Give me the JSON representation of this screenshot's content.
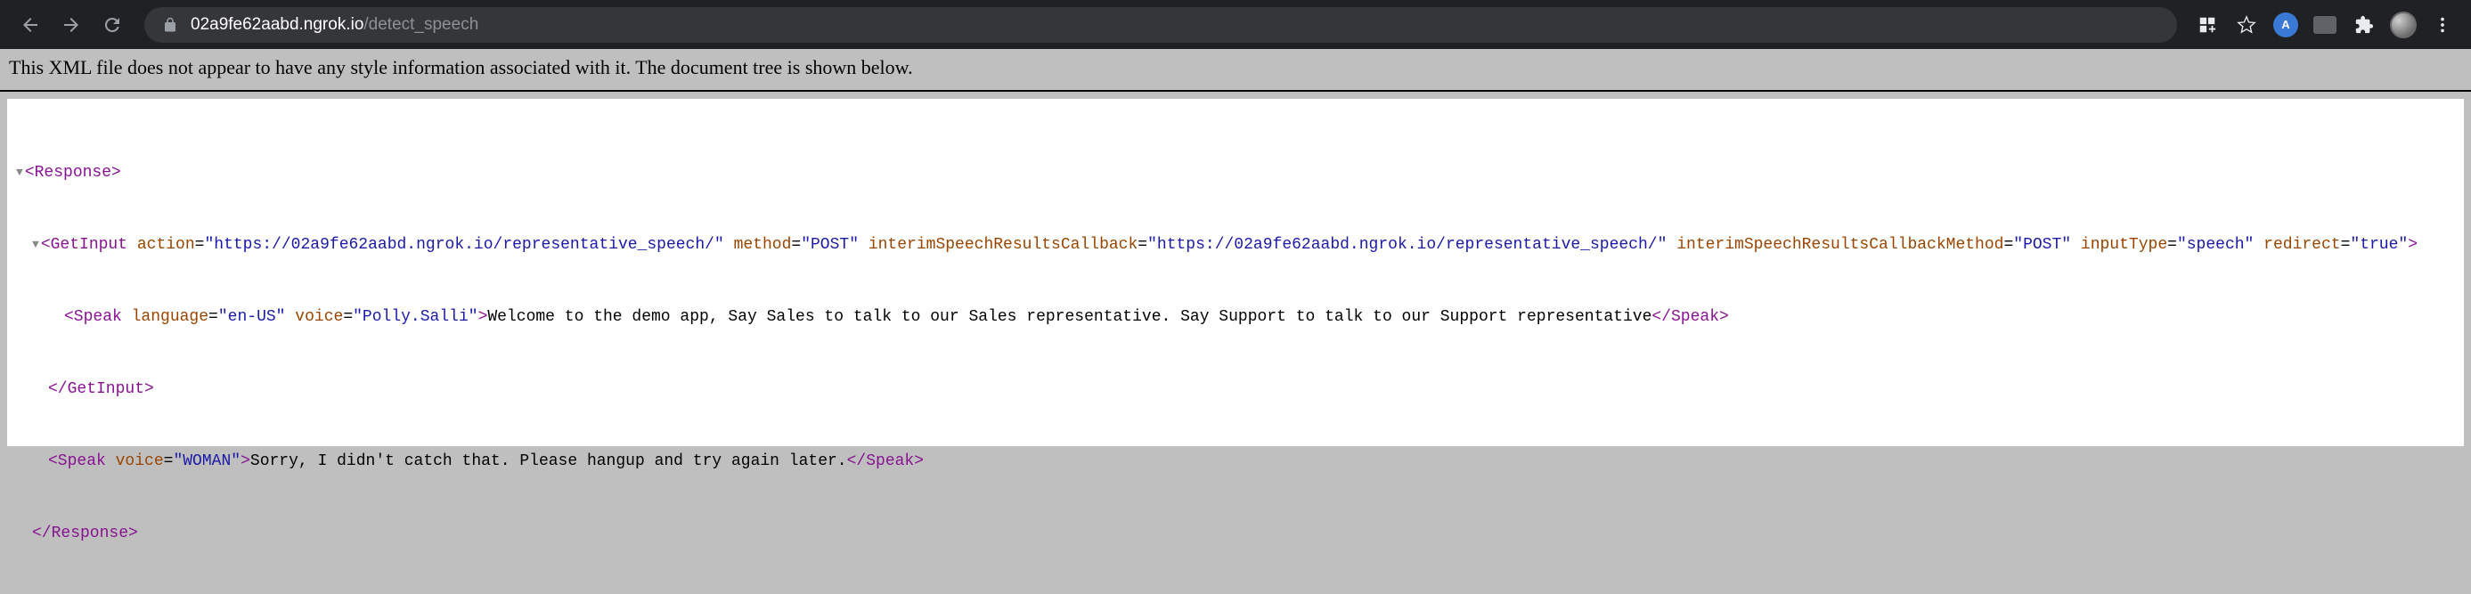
{
  "browser": {
    "url_host": "02a9fe62aabd.ngrok.io",
    "url_path": "/detect_speech"
  },
  "notice": "This XML file does not appear to have any style information associated with it. The document tree is shown below.",
  "xml": {
    "response_open": "<Response>",
    "response_close": "</Response>",
    "getinput_open_tag": "<GetInput",
    "getinput_attrs": {
      "action_name": "action",
      "action_value": "\"https://02a9fe62aabd.ngrok.io/representative_speech/\"",
      "method_name": "method",
      "method_value": "\"POST\"",
      "interim_cb_name": "interimSpeechResultsCallback",
      "interim_cb_value": "\"https://02a9fe62aabd.ngrok.io/representative_speech/\"",
      "interim_cbm_name": "interimSpeechResultsCallbackMethod",
      "interim_cbm_value": "\"POST\"",
      "input_type_name": "inputType",
      "input_type_value": "\"speech\"",
      "redirect_name": "redirect",
      "redirect_value": "\"true\""
    },
    "getinput_open_close": ">",
    "getinput_close": "</GetInput>",
    "speak1_open_tag": "<Speak",
    "speak1_attrs": {
      "language_name": "language",
      "language_value": "\"en-US\"",
      "voice_name": "voice",
      "voice_value": "\"Polly.Salli\""
    },
    "speak1_open_close": ">",
    "speak1_text": "Welcome to the demo app, Say Sales to talk to our Sales representative. Say Support to talk to our Support representative",
    "speak1_close": "</Speak>",
    "speak2_open_tag": "<Speak",
    "speak2_attrs": {
      "voice_name": "voice",
      "voice_value": "\"WOMAN\""
    },
    "speak2_open_close": ">",
    "speak2_text": "Sorry, I didn't catch that. Please hangup and try again later.",
    "speak2_close": "</Speak>"
  }
}
